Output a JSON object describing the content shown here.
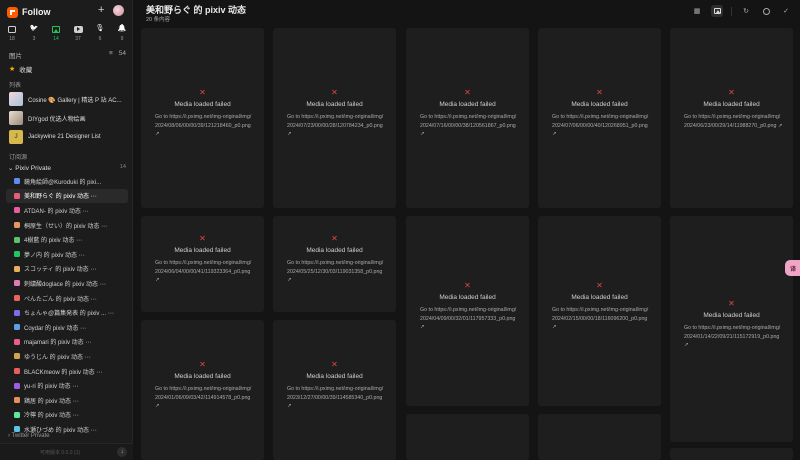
{
  "app": {
    "name": "Follow"
  },
  "views": [
    {
      "icon": "article-icon",
      "count": "18",
      "active": false
    },
    {
      "icon": "twitter-icon",
      "count": "3",
      "active": false
    },
    {
      "icon": "picture-icon",
      "count": "14",
      "active": true
    },
    {
      "icon": "video-icon",
      "count": "37",
      "active": false
    },
    {
      "icon": "microphone-icon",
      "count": "6",
      "active": false
    },
    {
      "icon": "notification-icon",
      "count": "9",
      "active": false
    }
  ],
  "section": {
    "title": "图片",
    "tool1": "≡",
    "tool2": "54"
  },
  "favorites": {
    "label": "收藏"
  },
  "lists": {
    "label": "列表",
    "items": [
      {
        "name": "Cosine 🎨 Gallery | 精选 P 站 AC..."
      },
      {
        "name": "DIYgod 优选人物绘画"
      },
      {
        "name": "Jackywine 21 Designer List",
        "letter": "J"
      }
    ]
  },
  "subscriptions": {
    "label": "订阅源",
    "folder": {
      "name": "Pixiv Private",
      "count": "14"
    },
    "feeds": [
      {
        "name": "鏡角絵師@Kuroduki 的 pixi...",
        "color": "#5b8def",
        "count": ""
      },
      {
        "name": "美和野らぐ 的 pixiv 动态 ⋯",
        "color": "#e85d75",
        "count": "",
        "active": true
      },
      {
        "name": "ATDAN- 的 pixiv 动态 ⋯",
        "color": "#e85d9f",
        "count": ""
      },
      {
        "name": "桐原生（せい）的 pixiv 动态 ⋯",
        "color": "#e8965d",
        "count": ""
      },
      {
        "name": "4樹藍 的 pixiv 动态 ⋯",
        "color": "#5dc16e",
        "count": ""
      },
      {
        "name": "夢ノ内 的 pixiv 动态 ⋯",
        "color": "#22c55e",
        "count": ""
      },
      {
        "name": "スコッティ 的 pixiv 动态 ⋯",
        "color": "#e8b05d",
        "count": ""
      },
      {
        "name": "刺繍酸doglace 的 pixiv 动态 ⋯",
        "color": "#e07ab4",
        "count": ""
      },
      {
        "name": "ぺんたごん 的 pixiv 动态 ⋯",
        "color": "#e8655d",
        "count": ""
      },
      {
        "name": "ちょんゃ@篇集発表 的 pixiv ... ⋯",
        "color": "#7a6de8",
        "count": ""
      },
      {
        "name": "Coydar 的 pixiv 动态 ⋯",
        "color": "#5d9fe8",
        "count": ""
      },
      {
        "name": "majamari 的 pixiv 动态 ⋯",
        "color": "#e85d8c",
        "count": ""
      },
      {
        "name": "ゆうじん 的 pixiv 动态 ⋯",
        "color": "#d4a24c",
        "count": ""
      },
      {
        "name": "BLACKmeow 的 pixiv 动态 ⋯",
        "color": "#e85d5d",
        "count": ""
      },
      {
        "name": "yu-ri 的 pixiv 动态 ⋯",
        "color": "#9b5de8",
        "count": ""
      },
      {
        "name": "鶏居 的 pixiv 动态 ⋯",
        "color": "#e8905d",
        "count": ""
      },
      {
        "name": "冷檸 的 pixiv 动态 ⋯",
        "color": "#5de89b",
        "count": ""
      },
      {
        "name": "水瀬ひづめ 的 pixiv 动态 ⋯",
        "color": "#5dc1e8",
        "count": ""
      }
    ],
    "folder2": "› Twitter Private"
  },
  "footer": {
    "version": "可用版本 0.0.0 (1)"
  },
  "main": {
    "title": "美和野らぐ 的 pixiv 动态",
    "subtitle": "20 条内容"
  },
  "cards": [
    {
      "error": "Media loaded failed",
      "link": "Go to https://i.pximg.net/img-original/img/2024/08/06/00/00/39/121218460_p0.png ↗"
    },
    {
      "error": "Media loaded failed",
      "link": "Go to https://i.pximg.net/img-original/img/2024/07/23/00/00/28/120784234_p0.png ↗"
    },
    {
      "error": "Media loaded failed",
      "link": "Go to https://i.pximg.net/img-original/img/2024/07/16/00/00/38/120561867_p0.png ↗"
    },
    {
      "error": "Media loaded failed",
      "link": "Go to https://i.pximg.net/img-original/img/2024/07/06/00/00/40/120268951_p0.png ↗"
    },
    {
      "error": "Media loaded failed",
      "link": "Go to https://i.pximg.net/img-original/img/2024/06/23/00/29/14/11988270_p0.png ↗"
    },
    {
      "error": "Media loaded failed",
      "link": "Go to https://i.pximg.net/img-original/img/2024/06/04/00/00/41/119323364_p0.png ↗"
    },
    {
      "error": "Media loaded failed",
      "link": "Go to https://i.pximg.net/img-original/img/2024/05/25/12/30/03/119031358_p0.png ↗"
    },
    {
      "error": "Media loaded failed",
      "link": "Go to https://i.pximg.net/img-original/img/2024/04/09/00/32/01/117957333_p0.png ↗"
    },
    {
      "error": "Media loaded failed",
      "link": "Go to https://i.pximg.net/img-original/img/2024/02/15/00/00/18/11609620​0_p0.png ↗"
    },
    {
      "error": "Media loaded failed",
      "link": "Go to https://i.pximg.net/img-original/img/2024/01/14/22/09/21/115172919_p0.png ↗"
    },
    {
      "error": "Media loaded failed",
      "link": "Go to https://i.pximg.net/img-original/img/2024/01/06/09/03/42/114914578_p0.png ↗"
    },
    {
      "error": "Media loaded failed",
      "link": "Go to https://i.pximg.net/img-original/img/2023/12/27/00/00/39/114585340_p0.png ↗"
    },
    {
      "error": "",
      "link": ""
    },
    {
      "error": "",
      "link": ""
    },
    {
      "error": "",
      "link": ""
    }
  ],
  "side_button": "译"
}
